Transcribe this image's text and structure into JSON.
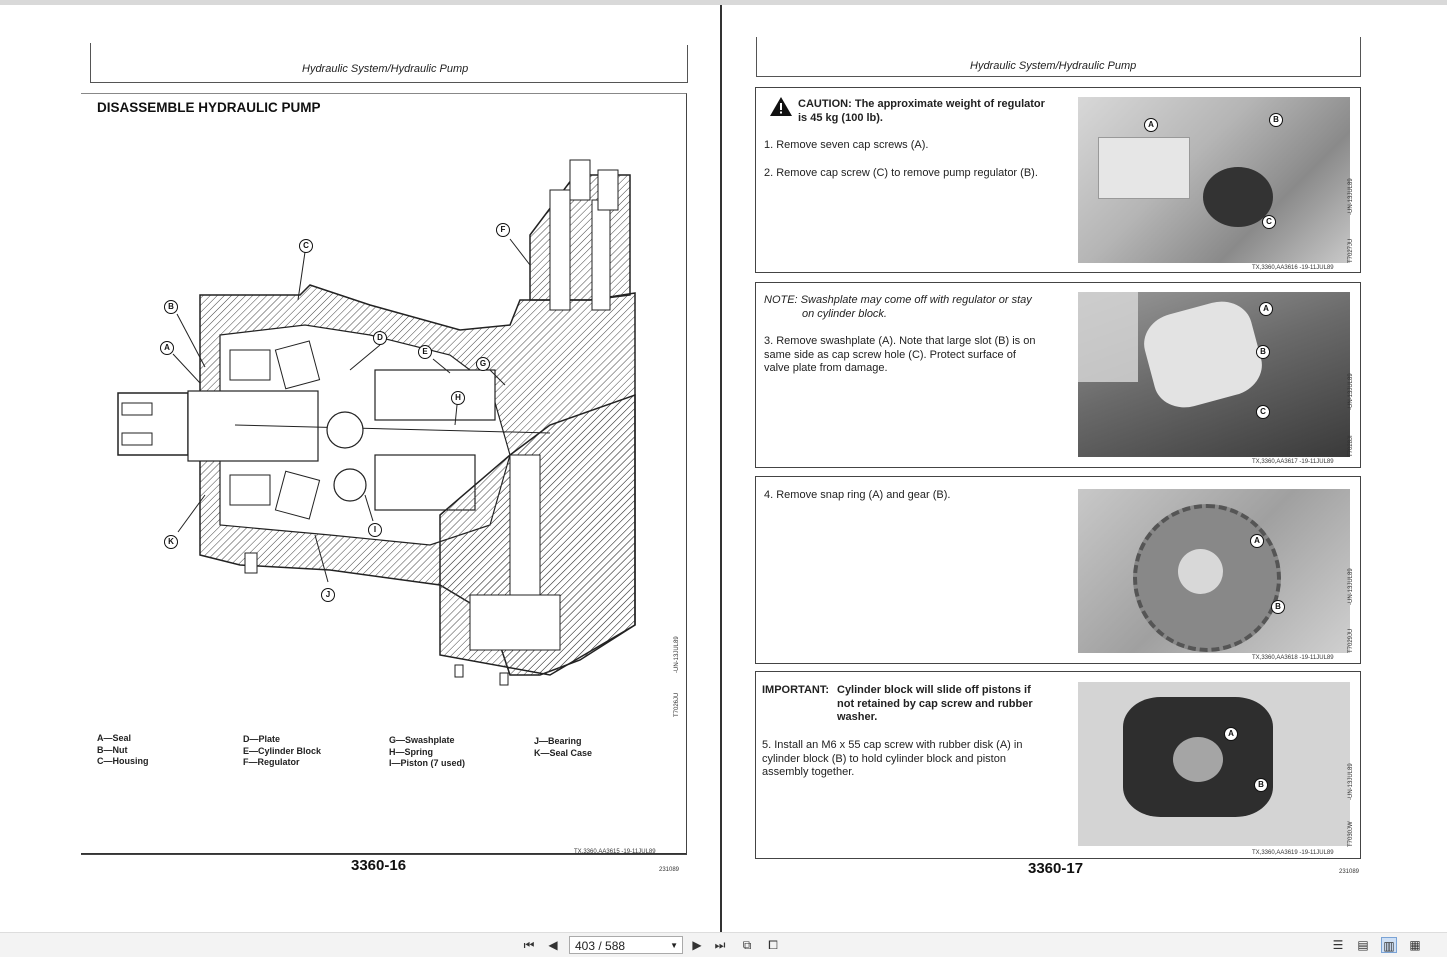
{
  "left_page": {
    "header": "Hydraulic System/Hydraulic Pump",
    "title": "DISASSEMBLE HYDRAULIC PUMP",
    "figure_id": "T7026JU",
    "figure_date": "-UN-13JUL89",
    "callouts": [
      "A",
      "B",
      "C",
      "D",
      "E",
      "F",
      "G",
      "H",
      "I",
      "J",
      "K"
    ],
    "legend": [
      [
        "A—Seal",
        "B—Nut",
        "C—Housing"
      ],
      [
        "D—Plate",
        "E—Cylinder Block",
        "F—Regulator"
      ],
      [
        "G—Swashplate",
        "H—Spring",
        "I—Piston (7 used)"
      ],
      [
        "J—Bearing",
        "K—Seal Case"
      ]
    ],
    "ref_code": "TX,3360,AA3615 -19-11JUL89",
    "page_number": "3360-16",
    "print_date": "231089"
  },
  "right_page": {
    "header": "Hydraulic System/Hydraulic Pump",
    "sections": [
      {
        "caution_label": "CAUTION:",
        "caution_text": "The approximate weight of regulator",
        "caution_text2": "is 45 kg (100 lb).",
        "steps": [
          "1. Remove seven cap screws (A).",
          "2. Remove cap screw (C) to remove pump regulator (B)."
        ],
        "photo_id": "T7027JU",
        "photo_date": "-UN-13JUL89",
        "callouts": [
          "A",
          "B",
          "C"
        ],
        "ref_code": "TX,3360,AA3616 -19-11JUL89"
      },
      {
        "note_label": "NOTE:",
        "note_text": "Swashplate may come off with regulator or stay",
        "note_text2": "on cylinder block.",
        "step_lines": [
          "3. Remove swashplate (A). Note that large slot (B) is on",
          "same side as cap screw hole (C). Protect surface of",
          "valve plate from damage."
        ],
        "photo_id": "T7028JI",
        "photo_date": "-UN-13JUL89",
        "callouts": [
          "A",
          "B",
          "C"
        ],
        "ref_code": "TX,3360,AA3617 -19-11JUL89"
      },
      {
        "step": "4. Remove snap ring (A) and gear (B).",
        "photo_id": "T7029JU",
        "photo_date": "-UN-13JUL89",
        "callouts": [
          "A",
          "B"
        ],
        "ref_code": "TX,3360,AA3618 -19-11JUL89"
      },
      {
        "important_label": "IMPORTANT:",
        "important_lines": [
          "Cylinder block will slide off pistons if",
          "not retained by cap screw and rubber",
          "washer."
        ],
        "step_lines": [
          "5. Install an M6 x 55 cap screw with rubber disk (A) in",
          "cylinder block (B) to hold cylinder block and piston",
          "assembly together."
        ],
        "photo_id": "T7030JW",
        "photo_date": "-UN-13JUL89",
        "callouts": [
          "A",
          "B"
        ],
        "ref_code": "TX,3360,AA3619 -19-11JUL89"
      }
    ],
    "page_number": "3360-17",
    "print_date": "231089"
  },
  "toolbar": {
    "page_indicator": "403 / 588",
    "icons": [
      "first-page-icon",
      "prev-page-icon",
      "next-page-icon",
      "last-page-icon",
      "fit-page-icon",
      "fit-width-icon",
      "single-page-icon",
      "continuous-icon",
      "two-page-icon",
      "two-page-continuous-icon"
    ]
  }
}
